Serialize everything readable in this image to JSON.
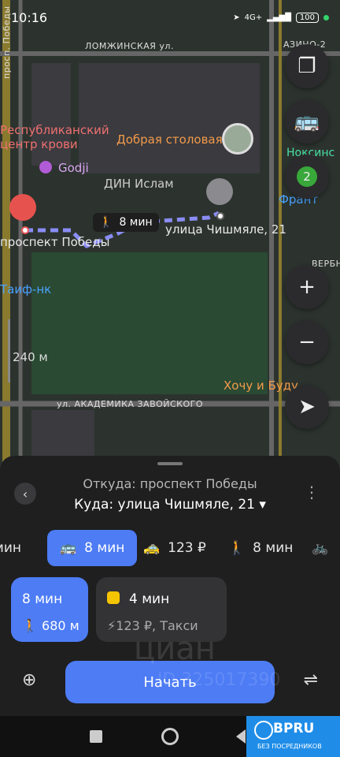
{
  "status": {
    "time": "10:16",
    "battery": "100",
    "net": "4G+"
  },
  "map": {
    "streets": [
      "просп. Победы",
      "ЛОМЖИНСКАЯ ул.",
      "ул. АКАДЕМИКА ЗАВОЙСКОГО"
    ],
    "pois": {
      "blood_center_1": "Республиканский",
      "blood_center_2": "центр крови",
      "cafe": "Добрая столовая",
      "godji": "Godji",
      "din": "ДИН Ислам",
      "origin": "проспект Победы",
      "destination": "улица Чишмяле, 21",
      "taif": "Таиф-нк",
      "azino": "АЗИНО-2",
      "noksin": "Ноксинс",
      "frant": "Франт",
      "verbn": "ВЕРБН",
      "hochu": "Хочу и Буду",
      "scale": "240 м"
    },
    "walk_badge": "8 мин",
    "layers_badge": "2"
  },
  "route": {
    "from": "Откуда: проспект Победы",
    "to": "Куда: улица Чишмяле, 21",
    "modes": [
      {
        "label": "мин"
      },
      {
        "label": "8 мин"
      },
      {
        "label": "123 ₽"
      },
      {
        "label": "8 мин"
      }
    ],
    "card_transit": {
      "time": "8 мин",
      "walk": "680 м"
    },
    "card_taxi": {
      "time": "4 мин",
      "price": "123 ₽, Такси"
    },
    "start_button": "Начать"
  },
  "watermark": {
    "line1": "циан",
    "line2": "ID 325017390"
  },
  "badge": {
    "title": "BPRU",
    "subtitle": "БЕЗ ПОСРЕДНИКОВ"
  },
  "colors": {
    "accent": "#4d7cf5",
    "panel": "#1f1f20",
    "map": "#2f3a33"
  }
}
